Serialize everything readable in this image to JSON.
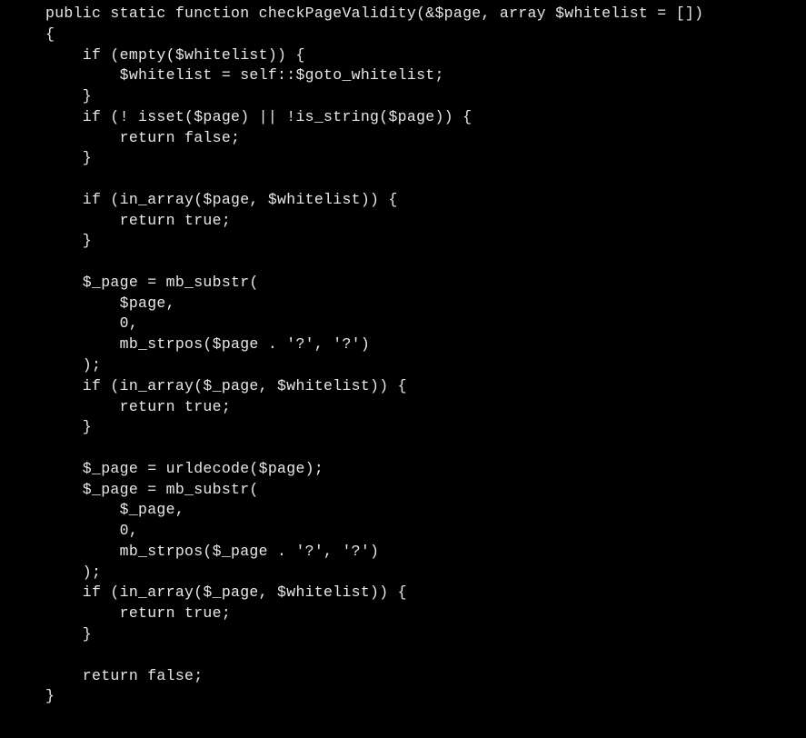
{
  "code": {
    "language": "php",
    "function_name": "checkPageValidity",
    "lines": [
      "public static function checkPageValidity(&$page, array $whitelist = [])",
      "{",
      "    if (empty($whitelist)) {",
      "        $whitelist = self::$goto_whitelist;",
      "    }",
      "    if (! isset($page) || !is_string($page)) {",
      "        return false;",
      "    }",
      "",
      "    if (in_array($page, $whitelist)) {",
      "        return true;",
      "    }",
      "",
      "    $_page = mb_substr(",
      "        $page,",
      "        0,",
      "        mb_strpos($page . '?', '?')",
      "    );",
      "    if (in_array($_page, $whitelist)) {",
      "        return true;",
      "    }",
      "",
      "    $_page = urldecode($page);",
      "    $_page = mb_substr(",
      "        $_page,",
      "        0,",
      "        mb_strpos($_page . '?', '?')",
      "    );",
      "    if (in_array($_page, $whitelist)) {",
      "        return true;",
      "    }",
      "",
      "    return false;",
      "}"
    ]
  }
}
